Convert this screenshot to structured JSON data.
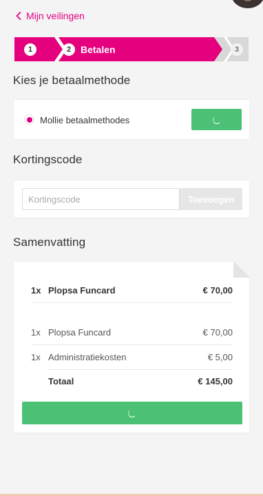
{
  "nav": {
    "back_label": "Mijn veilingen"
  },
  "stepper": {
    "steps": [
      {
        "number": "1",
        "label": "",
        "state": "done"
      },
      {
        "number": "2",
        "label": "Betalen",
        "state": "active"
      },
      {
        "number": "3",
        "label": "",
        "state": "upcoming"
      }
    ]
  },
  "payment": {
    "title": "Kies je betaalmethode",
    "method_label": "Mollie betaalmethodes"
  },
  "coupon": {
    "title": "Kortingscode",
    "placeholder": "Kortingscode",
    "button_label": "Toevoegen"
  },
  "summary": {
    "title": "Samenvatting",
    "header_item": {
      "qty": "1x",
      "name": "Plopsa Funcard",
      "price": "€ 70,00"
    },
    "items": [
      {
        "qty": "1x",
        "name": "Plopsa Funcard",
        "price": "€ 70,00"
      },
      {
        "qty": "1x",
        "name": "Administratiekosten",
        "price": "€ 5,00"
      }
    ],
    "total_label": "Totaal",
    "total_value": "€ 145,00"
  },
  "colors": {
    "accent": "#e5007d",
    "success": "#4cc175",
    "inactive": "#d8d8d8"
  }
}
